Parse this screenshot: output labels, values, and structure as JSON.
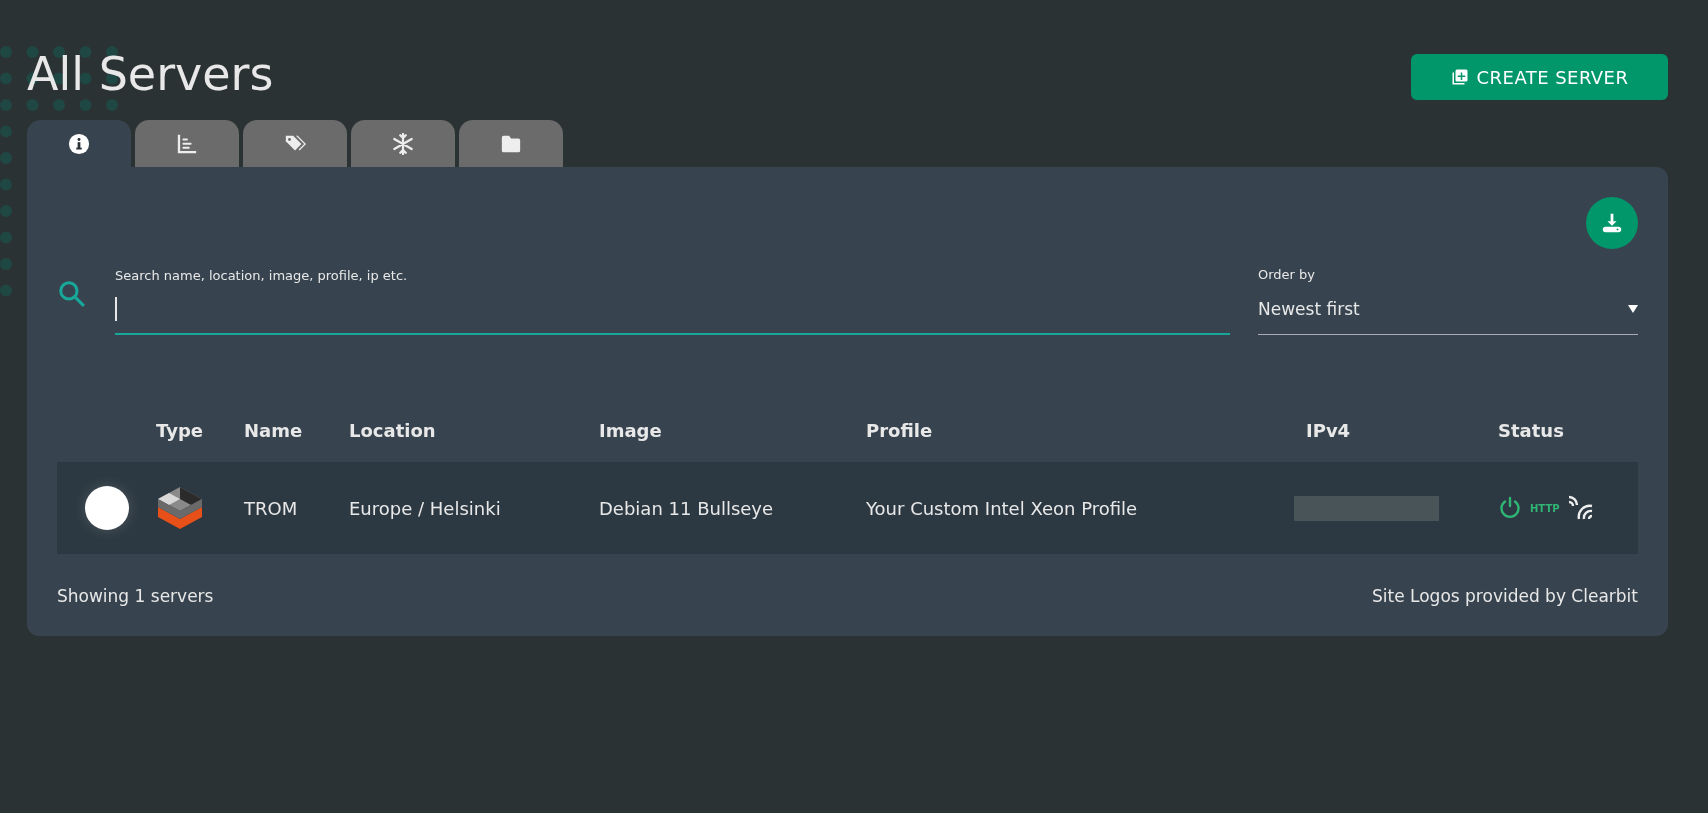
{
  "page": {
    "title": "All Servers"
  },
  "create_button": {
    "label": "CREATE SERVER"
  },
  "tabs": [
    {
      "kind": "info",
      "selected": true
    },
    {
      "kind": "chart",
      "selected": false
    },
    {
      "kind": "tags",
      "selected": false
    },
    {
      "kind": "snowflake",
      "selected": false
    },
    {
      "kind": "folder",
      "selected": false
    }
  ],
  "search": {
    "label": "Search name, location, image, profile, ip etc."
  },
  "order_by": {
    "label": "Order by",
    "value": "Newest first"
  },
  "table": {
    "columns": [
      "Type",
      "Name",
      "Location",
      "Image",
      "Profile",
      "IPv4",
      "Status"
    ],
    "rows": [
      {
        "name": "TROM",
        "location": "Europe / Helsinki",
        "image": "Debian 11 Bullseye",
        "profile": "Your Custom Intel Xeon Profile",
        "powered": true,
        "protocol": "HTTP"
      }
    ]
  },
  "footer": {
    "count": "Showing 1 servers",
    "credit": "Site Logos provided by Clearbit"
  }
}
